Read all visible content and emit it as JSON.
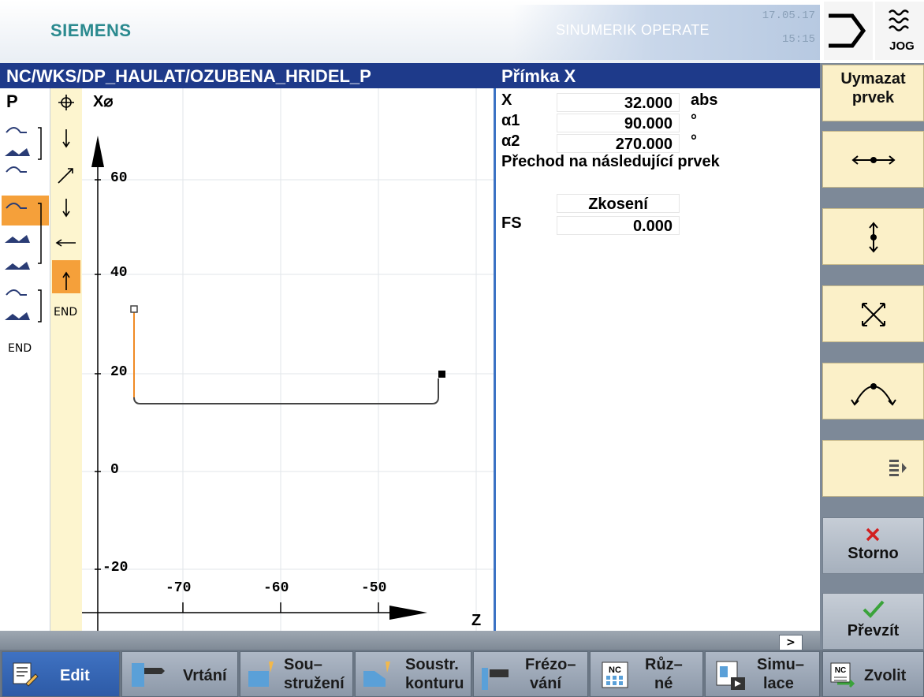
{
  "header": {
    "brand": "SIEMENS",
    "product": "SINUMERIK OPERATE",
    "date": "17.05.17",
    "time": "15:15",
    "mode_label": "JOG"
  },
  "title_bar": {
    "path": "NC/WKS/DP_HAULAT/OZUBENA_HRIDEL_P",
    "panel_title": "Přímka X"
  },
  "element_strip": {
    "top_label": "P",
    "end_label": "END"
  },
  "contour_strip": {
    "end_label": "END"
  },
  "graphic": {
    "x_axis_label": "X⌀",
    "z_axis_label": "Z",
    "x_ticks": [
      "60",
      "40",
      "20",
      "0",
      "-20"
    ],
    "z_ticks": [
      "-70",
      "-60",
      "-50"
    ]
  },
  "params": {
    "x_label": "X",
    "x_value": "32.000",
    "x_unit": "abs",
    "a1_label": "α1",
    "a1_value": "90.000",
    "a1_unit": "°",
    "a2_label": "α2",
    "a2_value": "270.000",
    "a2_unit": "°",
    "transition_label": "Přechod na následující prvek",
    "transition_value": "Zkosení",
    "fs_label": "FS",
    "fs_value": "0.000"
  },
  "vertical_softkeys": {
    "delete_line1": "Uymazat",
    "delete_line2": "prvek",
    "cancel": "Storno",
    "accept": "Převzít"
  },
  "status": {
    "more": ">"
  },
  "horizontal_softkeys": {
    "edit": "Edit",
    "drilling": "Vrtání",
    "turning_l1": "Sou–",
    "turning_l2": "stružení",
    "contour_turning_l1": "Soustr.",
    "contour_turning_l2": "konturu",
    "milling_l1": "Frézo–",
    "milling_l2": "vání",
    "misc_l1": "Růz–",
    "misc_l2": "né",
    "sim_l1": "Simu–",
    "sim_l2": "lace",
    "select": "Zvolit"
  },
  "colors": {
    "title_bar": "#1e3a8a",
    "selected": "#f5a03a",
    "contour_strip": "#fdf5cf",
    "softkey": "#fbf0c8",
    "contour_line": "#444444",
    "contour_active": "#f08a24"
  }
}
